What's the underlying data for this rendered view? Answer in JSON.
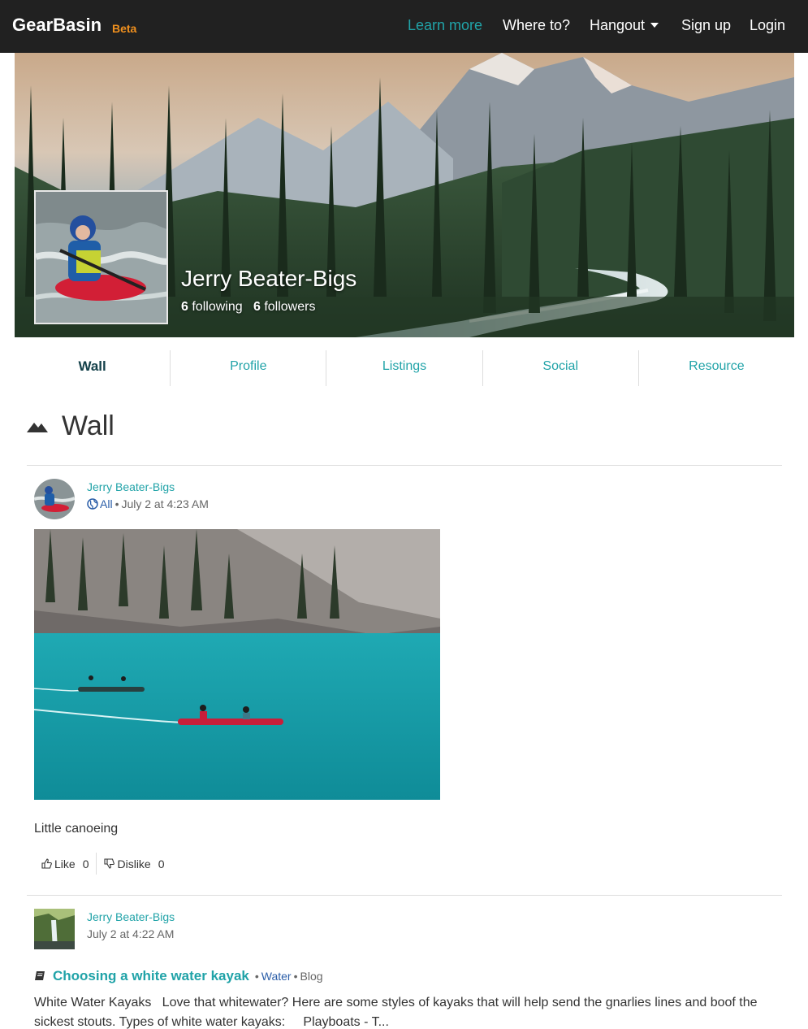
{
  "navbar": {
    "brand": "GearBasin",
    "beta": "Beta",
    "links": [
      "Learn more",
      "Where to?",
      "Hangout",
      "Sign up",
      "Login"
    ]
  },
  "profile": {
    "name": "Jerry Beater-Bigs",
    "following_count": "6",
    "following_label": "following",
    "followers_count": "6",
    "followers_label": "followers"
  },
  "tabs": [
    "Wall",
    "Profile",
    "Listings",
    "Social",
    "Resource"
  ],
  "section": {
    "title": "Wall",
    "icon": "mountain-icon"
  },
  "posts": [
    {
      "author": "Jerry Beater-Bigs",
      "audience": "All",
      "audience_icon": "globe-icon",
      "time": "July 2 at 4:23 AM",
      "caption": "Little canoeing",
      "like_label": "Like",
      "like_count": "0",
      "dislike_label": "Dislike",
      "dislike_count": "0"
    },
    {
      "author": "Jerry Beater-Bigs",
      "time": "July 2 at 4:22 AM",
      "blog_icon": "book-icon",
      "blog_title": "Choosing a white water kayak",
      "tag": "Water",
      "type": "Blog",
      "excerpt": "White Water Kayaks   Love that whitewater? Here are some styles of kayaks that will help send the gnarlies lines and boof the sickest stouts. Types of white water kayaks:     Playboats - T..."
    }
  ],
  "colors": {
    "navbar_bg": "#212121",
    "accent_teal": "#21a3a8",
    "beta_orange": "#f0901e",
    "active_tab": "#14414a",
    "audience_blue": "#2b5ea8"
  }
}
